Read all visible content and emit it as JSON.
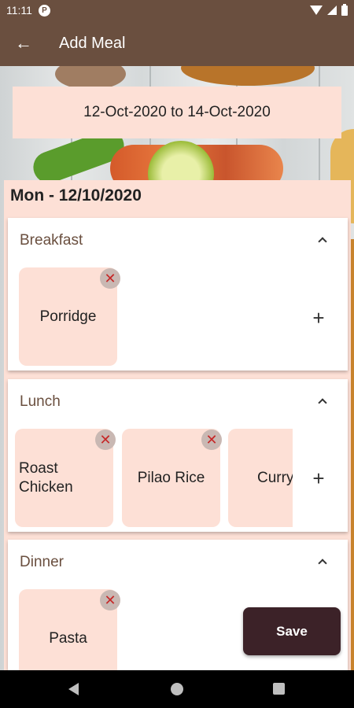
{
  "status_bar": {
    "time": "11:11",
    "notification_icon": "P"
  },
  "app_bar": {
    "title": "Add Meal"
  },
  "date_range": {
    "text": "12-Oct-2020 to 14-Oct-2020"
  },
  "day": {
    "header": "Mon  -  12/10/2020"
  },
  "meals": {
    "breakfast": {
      "title": "Breakfast",
      "items": [
        "Porridge"
      ]
    },
    "lunch": {
      "title": "Lunch",
      "items": [
        "Roast\nChicken",
        "Pilao Rice",
        "Curry"
      ]
    },
    "dinner": {
      "title": "Dinner",
      "items": [
        "Pasta"
      ]
    }
  },
  "icons": {
    "remove": "✕",
    "add": "+",
    "back": "←"
  },
  "save_button": {
    "label": "Save"
  },
  "colors": {
    "primary": "#6a4f3f",
    "card_tint": "#fde0d6",
    "save": "#3c2228",
    "remove": "#c62828"
  }
}
